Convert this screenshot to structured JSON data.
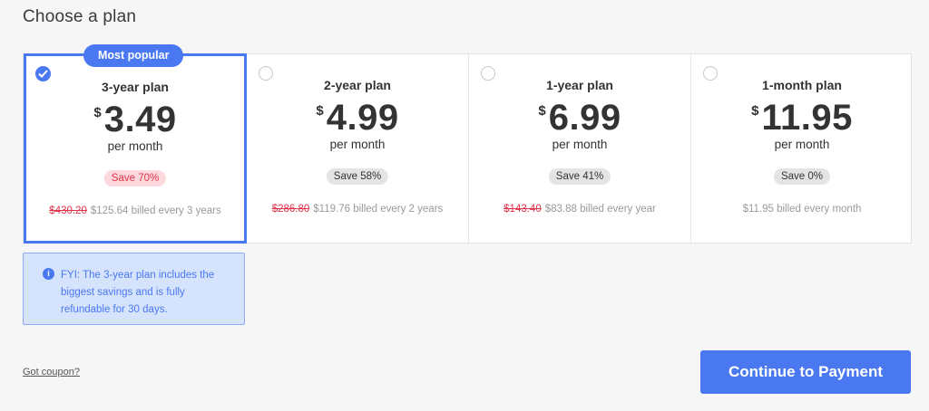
{
  "header": {
    "title": "Choose a plan"
  },
  "colors": {
    "accent": "#4a78f0",
    "danger": "#e0334a",
    "info_bg": "#d6e3fd"
  },
  "plans": [
    {
      "badge": "Most popular",
      "name": "3-year plan",
      "currency": "$",
      "price": "3.49",
      "per": "per month",
      "save": "Save 70%",
      "old_price": "$430.20",
      "billing": "$125.64 billed every 3 years",
      "selected": true
    },
    {
      "name": "2-year plan",
      "currency": "$",
      "price": "4.99",
      "per": "per month",
      "save": "Save 58%",
      "old_price": "$286.80",
      "billing": "$119.76 billed every 2 years",
      "selected": false
    },
    {
      "name": "1-year plan",
      "currency": "$",
      "price": "6.99",
      "per": "per month",
      "save": "Save 41%",
      "old_price": "$143.40",
      "billing": "$83.88 billed every year",
      "selected": false
    },
    {
      "name": "1-month plan",
      "currency": "$",
      "price": "11.95",
      "per": "per month",
      "save": "Save 0%",
      "billing": "$11.95 billed every month",
      "selected": false
    }
  ],
  "fyi": {
    "icon": "i",
    "text": "FYI: The 3-year plan includes the biggest savings and is fully refundable for 30 days."
  },
  "coupon": {
    "label": "Got coupon?"
  },
  "cta": {
    "label": "Continue to Payment"
  }
}
